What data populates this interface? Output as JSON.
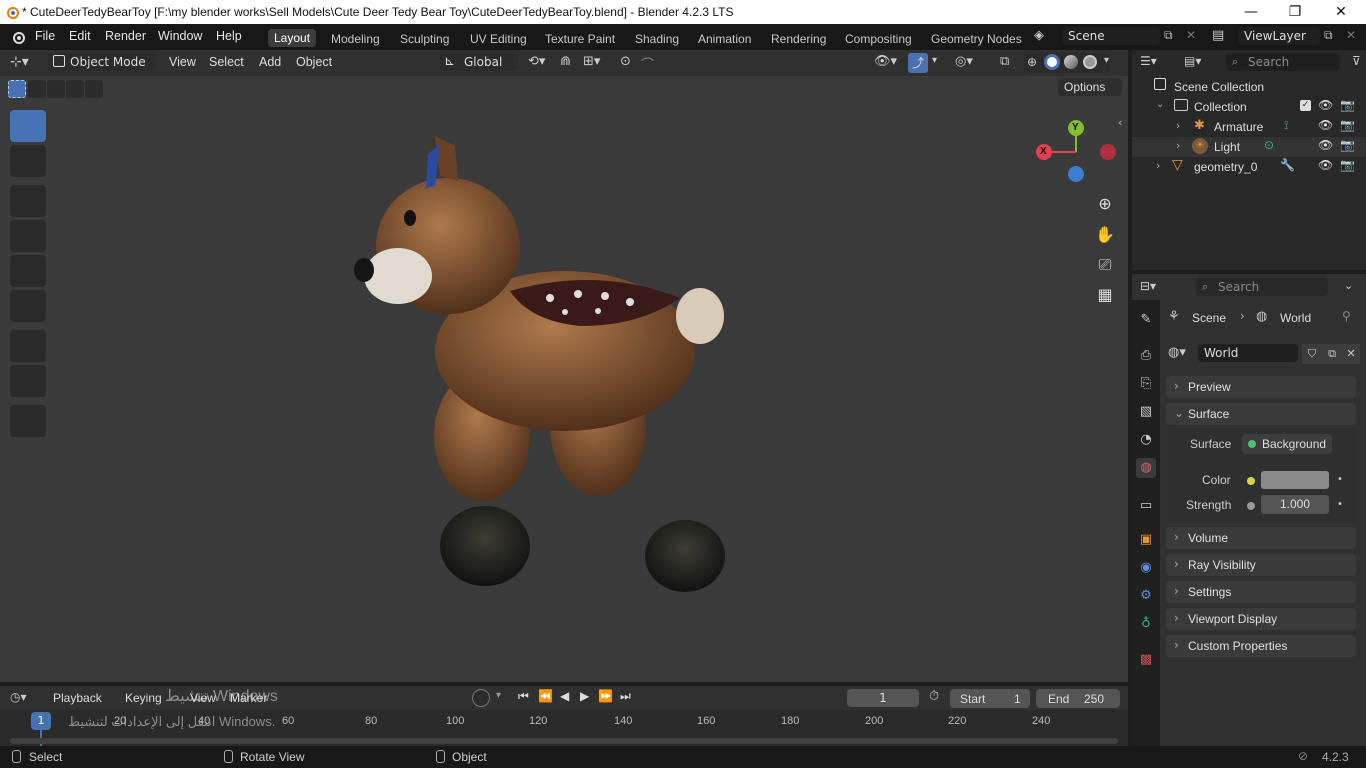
{
  "window": {
    "title": "* CuteDeerTedyBearToy [F:\\my blender works\\Sell Models\\Cute Deer Tedy Bear Toy\\CuteDeerTedyBearToy.blend] - Blender 4.2.3 LTS",
    "minimize": "—",
    "maximize": "❐",
    "close": "✕"
  },
  "menu": [
    "File",
    "Edit",
    "Render",
    "Window",
    "Help"
  ],
  "workspaces": [
    "Layout",
    "Modeling",
    "Sculpting",
    "UV Editing",
    "Texture Paint",
    "Shading",
    "Animation",
    "Rendering",
    "Compositing",
    "Geometry Nodes"
  ],
  "active_workspace": "Layout",
  "scene": {
    "name": "Scene",
    "view_layer": "ViewLayer"
  },
  "viewport_header": {
    "mode": "Object Mode",
    "menus": [
      "View",
      "Select",
      "Add",
      "Object"
    ],
    "orientation": "Global",
    "search_placeholder": "Search",
    "options": "Options"
  },
  "gizmo": {
    "x": "X",
    "y": "Y"
  },
  "outliner": {
    "root": "Scene Collection",
    "items": [
      {
        "name": "Collection",
        "icon": "collection-icon"
      },
      {
        "name": "Armature",
        "icon": "armature-icon"
      },
      {
        "name": "Light",
        "icon": "light-icon"
      },
      {
        "name": "geometry_0",
        "icon": "mesh-icon"
      }
    ]
  },
  "properties": {
    "search_placeholder": "Search",
    "breadcrumb": [
      "Scene",
      "World"
    ],
    "world_name": "World",
    "panels": {
      "preview": "Preview",
      "surface": "Surface",
      "volume": "Volume",
      "ray_visibility": "Ray Visibility",
      "settings": "Settings",
      "viewport_display": "Viewport Display",
      "custom_properties": "Custom Properties"
    },
    "surface_label": "Surface",
    "surface_value": "Background",
    "color_label": "Color",
    "strength_label": "Strength",
    "strength_value": "1.000",
    "color_swatch": "#8a8a8a"
  },
  "timeline": {
    "menus": [
      "Playback",
      "Keying",
      "View",
      "Marker"
    ],
    "current_frame": "1",
    "start_label": "Start",
    "start_value": "1",
    "end_label": "End",
    "end_value": "250",
    "ticks": [
      "1",
      "20",
      "40",
      "60",
      "80",
      "100",
      "120",
      "140",
      "160",
      "180",
      "200",
      "220",
      "240"
    ],
    "watermark_line1": "تنشيط Windows",
    "watermark_line2": "انتقل إلى الإعدادات لتنشيط Windows."
  },
  "statusbar": {
    "select": "Select",
    "rotate_view": "Rotate View",
    "object": "Object",
    "version": "4.2.3"
  },
  "colors": {
    "accent": "#4772b3",
    "x_axis": "#e04050",
    "y_axis": "#7fbf30",
    "z_axis": "#3a7dd0"
  }
}
